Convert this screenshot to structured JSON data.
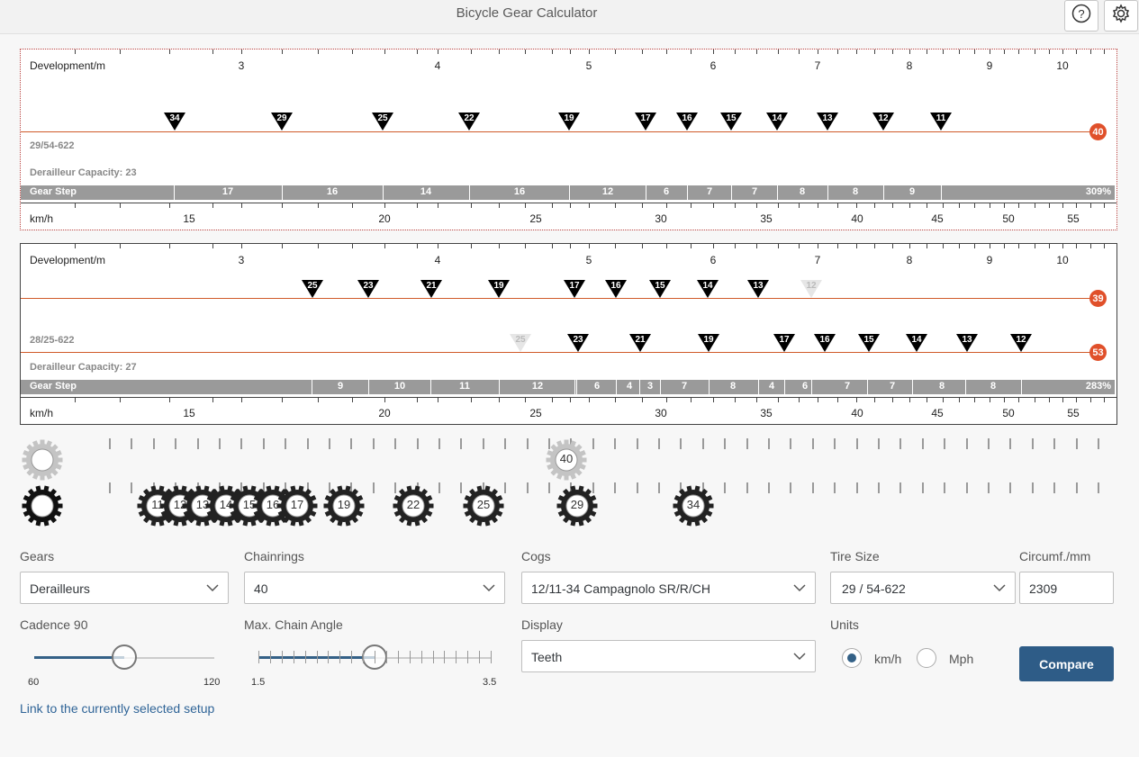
{
  "app": {
    "title": "Bicycle Gear Calculator"
  },
  "header": {
    "help_icon": "help-icon",
    "settings_icon": "gear-icon"
  },
  "dev_ticks": [
    "3",
    "4",
    "5",
    "6",
    "7",
    "8",
    "9",
    "10"
  ],
  "kmh_ticks": [
    "15",
    "20",
    "25",
    "30",
    "35",
    "40",
    "45",
    "50",
    "55"
  ],
  "panel1": {
    "dev_label": "Development/m",
    "setup": "29/54-622",
    "capacity": "Derailleur Capacity: 23",
    "gear_step_label": "Gear Step",
    "kmh_label": "km/h",
    "chainring": "40",
    "cogs": [
      "34",
      "29",
      "25",
      "22",
      "19",
      "17",
      "16",
      "15",
      "14",
      "13",
      "12",
      "11"
    ],
    "steps": [
      "17",
      "16",
      "14",
      "16",
      "12",
      "6",
      "7",
      "7",
      "8",
      "8",
      "9",
      "309%"
    ]
  },
  "panel2": {
    "dev_label": "Development/m",
    "setup": "28/25-622",
    "capacity": "Derailleur Capacity: 27",
    "gear_step_label": "Gear Step",
    "kmh_label": "km/h",
    "ring1": "39",
    "ring2": "53",
    "cogs1": [
      "25",
      "23",
      "21",
      "19",
      "17",
      "16",
      "15",
      "14",
      "13",
      "12"
    ],
    "cogs2": [
      "25",
      "23",
      "21",
      "19",
      "17",
      "16",
      "15",
      "14",
      "13",
      "12"
    ],
    "steps": [
      "9",
      "10",
      "11",
      "12",
      "6",
      "4",
      "3",
      "7",
      "8",
      "4",
      "6",
      "7",
      "7",
      "8",
      "8",
      "283%"
    ]
  },
  "visual": {
    "chainring_label": "40",
    "cog_labels": [
      "11",
      "12",
      "13",
      "14",
      "15",
      "16",
      "17",
      "19",
      "22",
      "25",
      "29",
      "34"
    ]
  },
  "form": {
    "gears_label": "Gears",
    "gears_value": "Derailleurs",
    "chainrings_label": "Chainrings",
    "chainrings_value": "40",
    "cogs_label": "Cogs",
    "cogs_value": "12/11-34 Campagnolo SR/R/CH",
    "tire_label": "Tire Size",
    "tire_value": "29 / 54-622",
    "circ_label": "Circumf./mm",
    "circ_value": "2309",
    "cadence_label": "Cadence 90",
    "cadence_min": "60",
    "cadence_max": "120",
    "cadence_value": 90,
    "angle_label": "Max. Chain Angle",
    "angle_min": "1.5",
    "angle_max": "3.5",
    "angle_value": 2.5,
    "display_label": "Display",
    "display_value": "Teeth",
    "units_label": "Units",
    "unit_kmh": "km/h",
    "unit_mph": "Mph",
    "compare_label": "Compare",
    "link_text": "Link to the currently selected setup"
  }
}
